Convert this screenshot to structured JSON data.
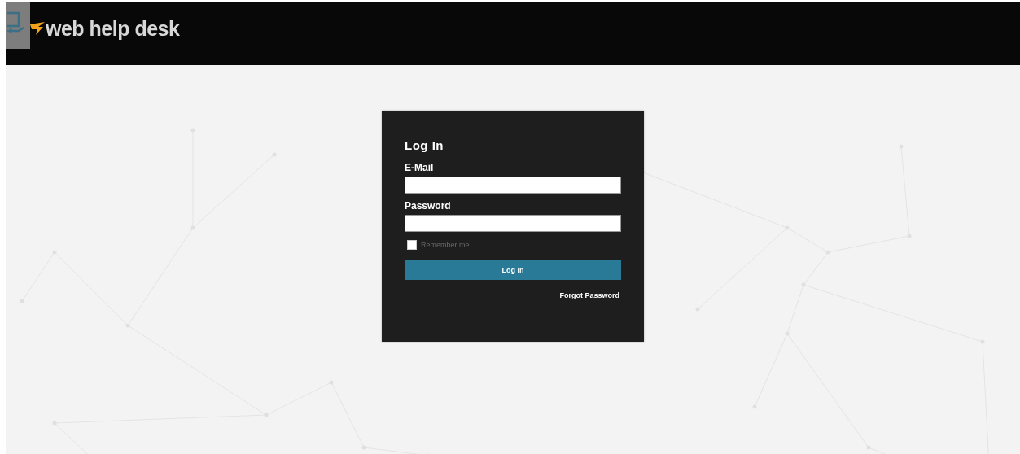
{
  "header": {
    "logo": "web help desk"
  },
  "login": {
    "title": "Log In",
    "fields": [
      {
        "label": "E-Mail"
      },
      {
        "label": "Password"
      }
    ],
    "remember": {
      "label": "Remember me",
      "checked": false
    },
    "submit": "Log In",
    "forgot": "Forgot Password"
  }
}
